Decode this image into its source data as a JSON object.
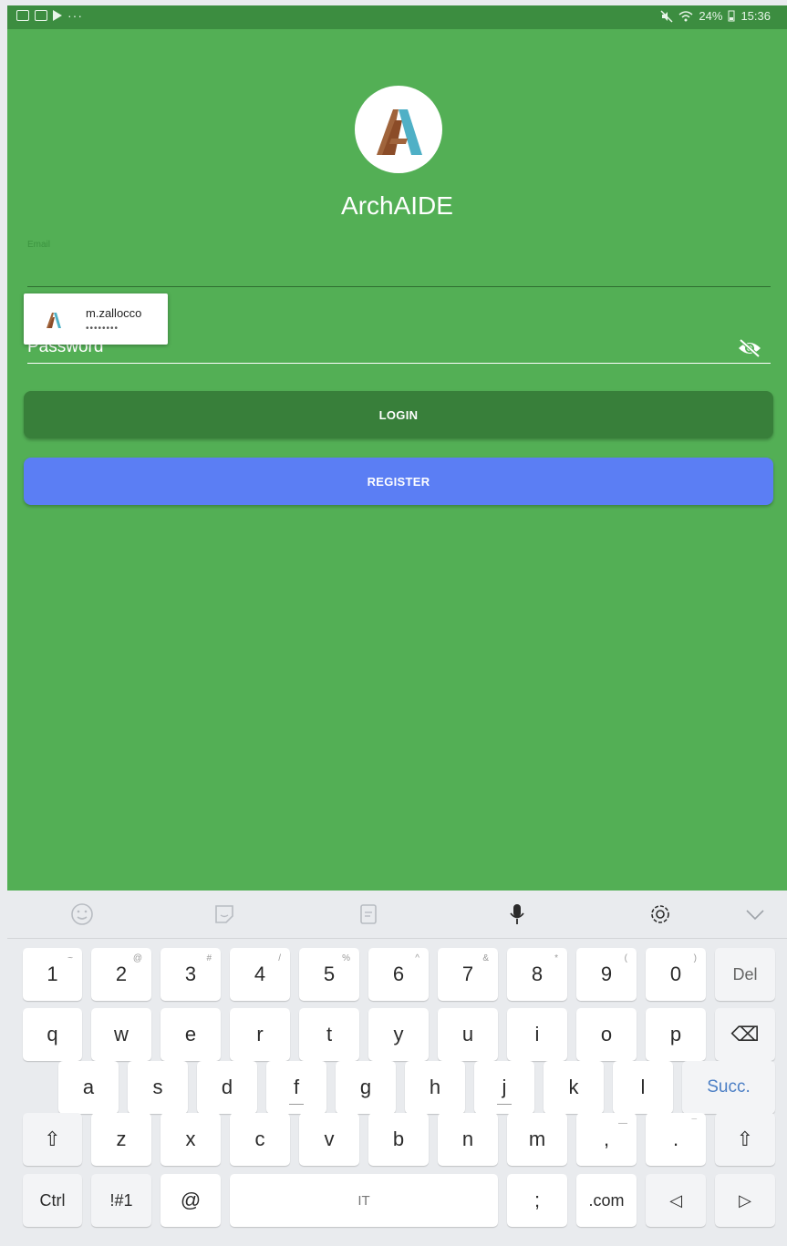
{
  "status_bar": {
    "dots": "···",
    "battery": "24%",
    "time": "15:36"
  },
  "app": {
    "title": "ArchAIDE",
    "email_label": "Email",
    "password_label": "Password",
    "login_button": "LOGIN",
    "register_button": "REGISTER",
    "autofill": {
      "username": "m.zallocco",
      "password_mask": "••••••••"
    },
    "colors": {
      "background": "#53af55",
      "login": "#387f3a",
      "register": "#5b7ef4",
      "logo_brown": "#a0643c",
      "logo_teal": "#4fb0c6"
    }
  },
  "keyboard": {
    "toolbar": [
      "emoji-icon",
      "sticker-icon",
      "clipboard-icon",
      "microphone-icon",
      "settings-icon",
      "collapse-icon"
    ],
    "rows": [
      [
        {
          "label": "1",
          "sub": "~"
        },
        {
          "label": "2",
          "sub": "@"
        },
        {
          "label": "3",
          "sub": "#"
        },
        {
          "label": "4",
          "sub": "/"
        },
        {
          "label": "5",
          "sub": "%"
        },
        {
          "label": "6",
          "sub": "^"
        },
        {
          "label": "7",
          "sub": "&"
        },
        {
          "label": "8",
          "sub": "*"
        },
        {
          "label": "9",
          "sub": "("
        },
        {
          "label": "0",
          "sub": ")"
        },
        {
          "label": "Del",
          "sub": ""
        }
      ],
      [
        {
          "label": "q"
        },
        {
          "label": "w"
        },
        {
          "label": "e"
        },
        {
          "label": "r"
        },
        {
          "label": "t"
        },
        {
          "label": "y"
        },
        {
          "label": "u"
        },
        {
          "label": "i"
        },
        {
          "label": "o"
        },
        {
          "label": "p"
        },
        {
          "label": "⌫"
        }
      ],
      [
        {
          "label": "a"
        },
        {
          "label": "s"
        },
        {
          "label": "d"
        },
        {
          "label": "f"
        },
        {
          "label": "g"
        },
        {
          "label": "h"
        },
        {
          "label": "j"
        },
        {
          "label": "k"
        },
        {
          "label": "l"
        },
        {
          "label": "Succ."
        }
      ],
      [
        {
          "label": "⇧"
        },
        {
          "label": "z"
        },
        {
          "label": "x"
        },
        {
          "label": "c"
        },
        {
          "label": "v"
        },
        {
          "label": "b"
        },
        {
          "label": "n"
        },
        {
          "label": "m"
        },
        {
          "label": ",",
          "sub": "—"
        },
        {
          "label": ".",
          "sub": "¯"
        },
        {
          "label": "⇧"
        }
      ],
      [
        {
          "label": "Ctrl"
        },
        {
          "label": "!#1"
        },
        {
          "label": "@"
        },
        {
          "label": "IT"
        },
        {
          "label": ";"
        },
        {
          "label": ".com"
        },
        {
          "label": "◁"
        },
        {
          "label": "▷"
        }
      ]
    ]
  }
}
